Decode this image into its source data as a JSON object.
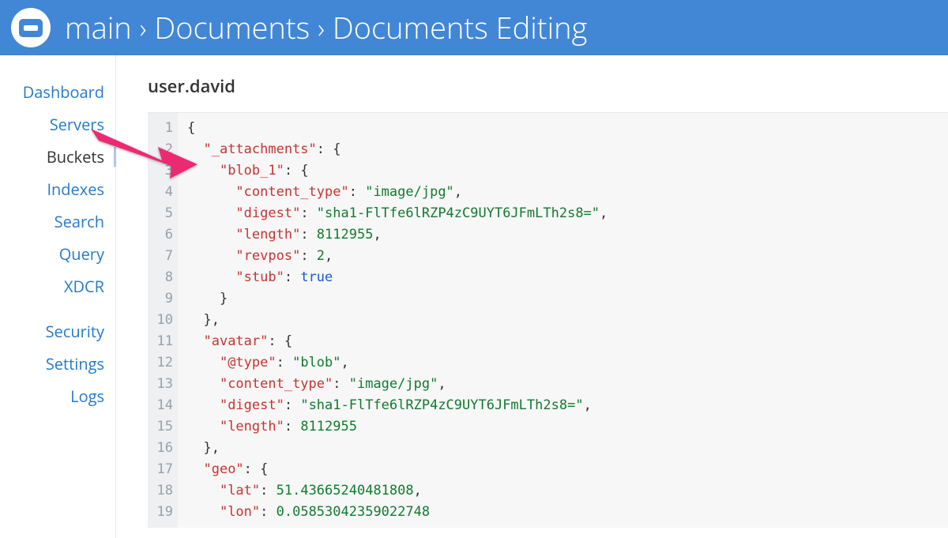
{
  "header": {
    "breadcrumb": [
      "main",
      "Documents",
      "Documents Editing"
    ]
  },
  "sidebar": {
    "items": [
      {
        "label": "Dashboard",
        "active": false
      },
      {
        "label": "Servers",
        "active": false
      },
      {
        "label": "Buckets",
        "active": true
      },
      {
        "label": "Indexes",
        "active": false
      },
      {
        "label": "Search",
        "active": false
      },
      {
        "label": "Query",
        "active": false
      },
      {
        "label": "XDCR",
        "active": false
      }
    ],
    "items2": [
      {
        "label": "Security",
        "active": false
      },
      {
        "label": "Settings",
        "active": false
      },
      {
        "label": "Logs",
        "active": false
      }
    ]
  },
  "document": {
    "title": "user.david",
    "lines": [
      {
        "n": "1",
        "tokens": [
          {
            "t": "{",
            "c": "p"
          }
        ]
      },
      {
        "n": "2",
        "tokens": [
          {
            "t": "  ",
            "c": "p"
          },
          {
            "t": "\"_attachments\"",
            "c": "k"
          },
          {
            "t": ": {",
            "c": "p"
          }
        ]
      },
      {
        "n": "3",
        "tokens": [
          {
            "t": "    ",
            "c": "p"
          },
          {
            "t": "\"blob_1\"",
            "c": "k"
          },
          {
            "t": ": {",
            "c": "p"
          }
        ]
      },
      {
        "n": "4",
        "tokens": [
          {
            "t": "      ",
            "c": "p"
          },
          {
            "t": "\"content_type\"",
            "c": "k"
          },
          {
            "t": ": ",
            "c": "p"
          },
          {
            "t": "\"image/jpg\"",
            "c": "s"
          },
          {
            "t": ",",
            "c": "p"
          }
        ]
      },
      {
        "n": "5",
        "tokens": [
          {
            "t": "      ",
            "c": "p"
          },
          {
            "t": "\"digest\"",
            "c": "k"
          },
          {
            "t": ": ",
            "c": "p"
          },
          {
            "t": "\"sha1-FlTfe6lRZP4zC9UYT6JFmLTh2s8=\"",
            "c": "s"
          },
          {
            "t": ",",
            "c": "p"
          }
        ]
      },
      {
        "n": "6",
        "tokens": [
          {
            "t": "      ",
            "c": "p"
          },
          {
            "t": "\"length\"",
            "c": "k"
          },
          {
            "t": ": ",
            "c": "p"
          },
          {
            "t": "8112955",
            "c": "n"
          },
          {
            "t": ",",
            "c": "p"
          }
        ]
      },
      {
        "n": "7",
        "tokens": [
          {
            "t": "      ",
            "c": "p"
          },
          {
            "t": "\"revpos\"",
            "c": "k"
          },
          {
            "t": ": ",
            "c": "p"
          },
          {
            "t": "2",
            "c": "n"
          },
          {
            "t": ",",
            "c": "p"
          }
        ]
      },
      {
        "n": "8",
        "tokens": [
          {
            "t": "      ",
            "c": "p"
          },
          {
            "t": "\"stub\"",
            "c": "k"
          },
          {
            "t": ": ",
            "c": "p"
          },
          {
            "t": "true",
            "c": "b"
          }
        ]
      },
      {
        "n": "9",
        "tokens": [
          {
            "t": "    }",
            "c": "p"
          }
        ]
      },
      {
        "n": "10",
        "tokens": [
          {
            "t": "  },",
            "c": "p"
          }
        ]
      },
      {
        "n": "11",
        "tokens": [
          {
            "t": "  ",
            "c": "p"
          },
          {
            "t": "\"avatar\"",
            "c": "k"
          },
          {
            "t": ": {",
            "c": "p"
          }
        ]
      },
      {
        "n": "12",
        "tokens": [
          {
            "t": "    ",
            "c": "p"
          },
          {
            "t": "\"@type\"",
            "c": "k"
          },
          {
            "t": ": ",
            "c": "p"
          },
          {
            "t": "\"blob\"",
            "c": "s"
          },
          {
            "t": ",",
            "c": "p"
          }
        ]
      },
      {
        "n": "13",
        "tokens": [
          {
            "t": "    ",
            "c": "p"
          },
          {
            "t": "\"content_type\"",
            "c": "k"
          },
          {
            "t": ": ",
            "c": "p"
          },
          {
            "t": "\"image/jpg\"",
            "c": "s"
          },
          {
            "t": ",",
            "c": "p"
          }
        ]
      },
      {
        "n": "14",
        "tokens": [
          {
            "t": "    ",
            "c": "p"
          },
          {
            "t": "\"digest\"",
            "c": "k"
          },
          {
            "t": ": ",
            "c": "p"
          },
          {
            "t": "\"sha1-FlTfe6lRZP4zC9UYT6JFmLTh2s8=\"",
            "c": "s"
          },
          {
            "t": ",",
            "c": "p"
          }
        ]
      },
      {
        "n": "15",
        "tokens": [
          {
            "t": "    ",
            "c": "p"
          },
          {
            "t": "\"length\"",
            "c": "k"
          },
          {
            "t": ": ",
            "c": "p"
          },
          {
            "t": "8112955",
            "c": "n"
          }
        ]
      },
      {
        "n": "16",
        "tokens": [
          {
            "t": "  },",
            "c": "p"
          }
        ]
      },
      {
        "n": "17",
        "tokens": [
          {
            "t": "  ",
            "c": "p"
          },
          {
            "t": "\"geo\"",
            "c": "k"
          },
          {
            "t": ": {",
            "c": "p"
          }
        ]
      },
      {
        "n": "18",
        "tokens": [
          {
            "t": "    ",
            "c": "p"
          },
          {
            "t": "\"lat\"",
            "c": "k"
          },
          {
            "t": ": ",
            "c": "p"
          },
          {
            "t": "51.43665240481808",
            "c": "n"
          },
          {
            "t": ",",
            "c": "p"
          }
        ]
      },
      {
        "n": "19",
        "tokens": [
          {
            "t": "    ",
            "c": "p"
          },
          {
            "t": "\"lon\"",
            "c": "k"
          },
          {
            "t": ": ",
            "c": "p"
          },
          {
            "t": "0.05853042359022748",
            "c": "n"
          }
        ]
      }
    ]
  },
  "annotation": {
    "color": "#ec2a72"
  }
}
